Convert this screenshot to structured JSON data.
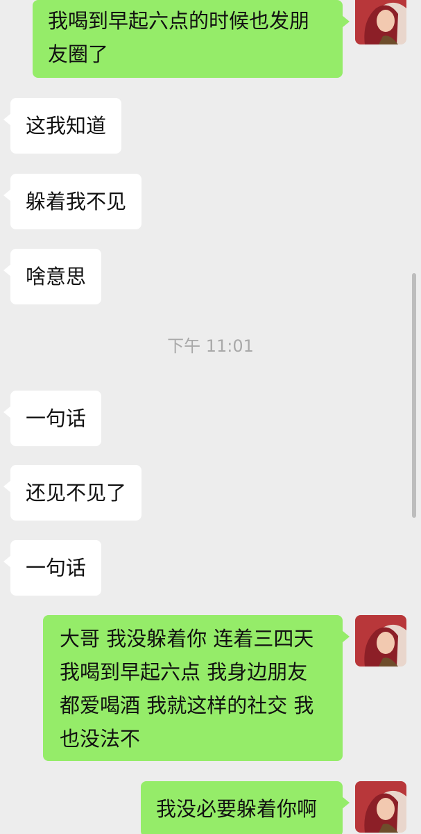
{
  "messages": [
    {
      "side": "out",
      "text": "我喝到早起六点的时候也发朋友圈了",
      "lines": [
        "我喝到早起六点的时候也发朋",
        "友圈了"
      ],
      "has_avatar": true
    },
    {
      "side": "in",
      "text": "这我知道"
    },
    {
      "side": "in",
      "text": "躲着我不见"
    },
    {
      "side": "in",
      "text": "啥意思"
    },
    {
      "side": "in",
      "text": "一句话"
    },
    {
      "side": "in",
      "text": "还见不见了"
    },
    {
      "side": "in",
      "text": "一句话"
    },
    {
      "side": "out",
      "text": "大哥 我没躲着你 连着三四天 我喝到早起六点 我身边朋友都爱喝酒 我就这样的社交 我也没法不",
      "lines": [
        "大哥 我没躲着你 连着三四天",
        "我喝到早起六点 我身边朋友",
        "都爱喝酒 我就这样的社交 我",
        "也没法不"
      ],
      "has_avatar": true
    },
    {
      "side": "out",
      "text": "我没必要躲着你啊",
      "has_avatar": true
    }
  ],
  "timestamp": "下午 11:01",
  "colors": {
    "background": "#ededed",
    "incoming_bubble": "#ffffff",
    "outgoing_bubble": "#95ec69",
    "timestamp_text": "#a9a9a9"
  }
}
